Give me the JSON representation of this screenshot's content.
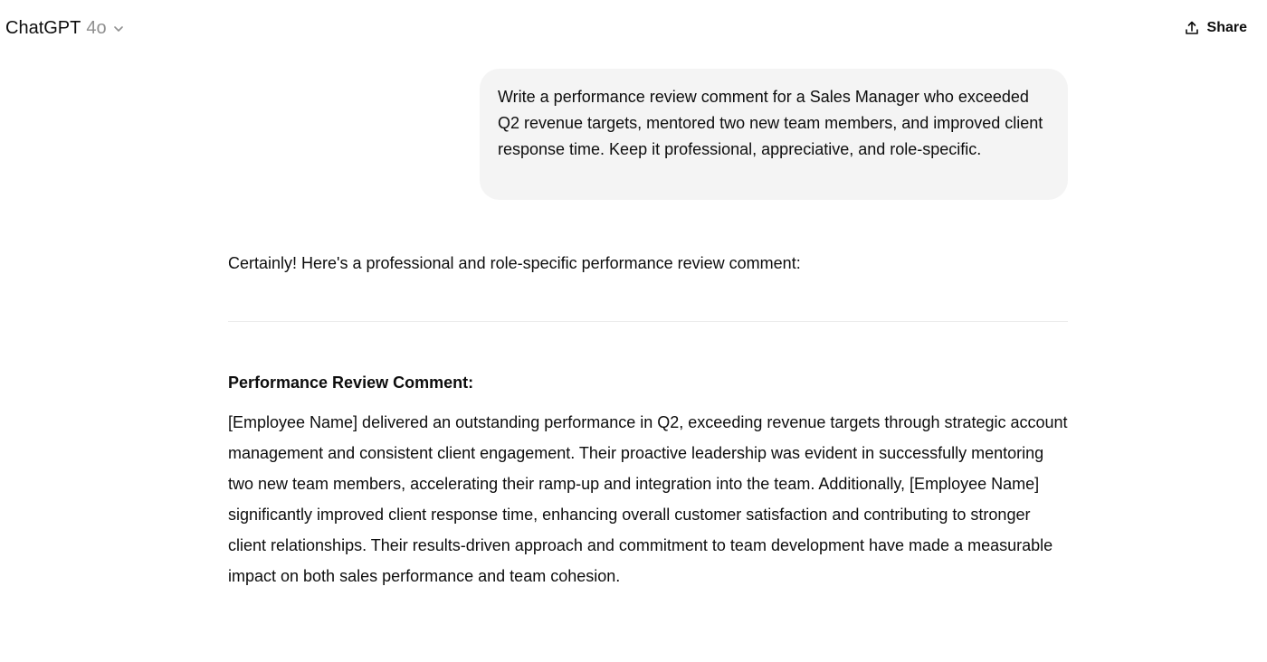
{
  "header": {
    "model_name": "ChatGPT",
    "model_version": "4o",
    "share_label": "Share"
  },
  "conversation": {
    "user_message": "Write a performance review comment for a Sales Manager who exceeded Q2 revenue targets, mentored two new team members, and improved client response time. Keep it professional, appreciative, and role-specific.",
    "assistant": {
      "intro": "Certainly! Here's a professional and role-specific performance review comment:",
      "section_heading": "Performance Review Comment:",
      "body": "[Employee Name] delivered an outstanding performance in Q2, exceeding revenue targets through strategic account management and consistent client engagement. Their proactive leadership was evident in successfully mentoring two new team members, accelerating their ramp-up and integration into the team. Additionally, [Employee Name] significantly improved client response time, enhancing overall customer satisfaction and contributing to stronger client relationships. Their results-driven approach and commitment to team development have made a measurable impact on both sales performance and team cohesion."
    }
  },
  "icons": {
    "model_dropdown": "chevron-down-icon",
    "share": "share-icon"
  },
  "colors": {
    "background": "#ffffff",
    "user_bubble": "#f4f4f4",
    "text": "#0d0d0d",
    "muted_text": "#8f8f8f",
    "divider": "#ececec"
  }
}
